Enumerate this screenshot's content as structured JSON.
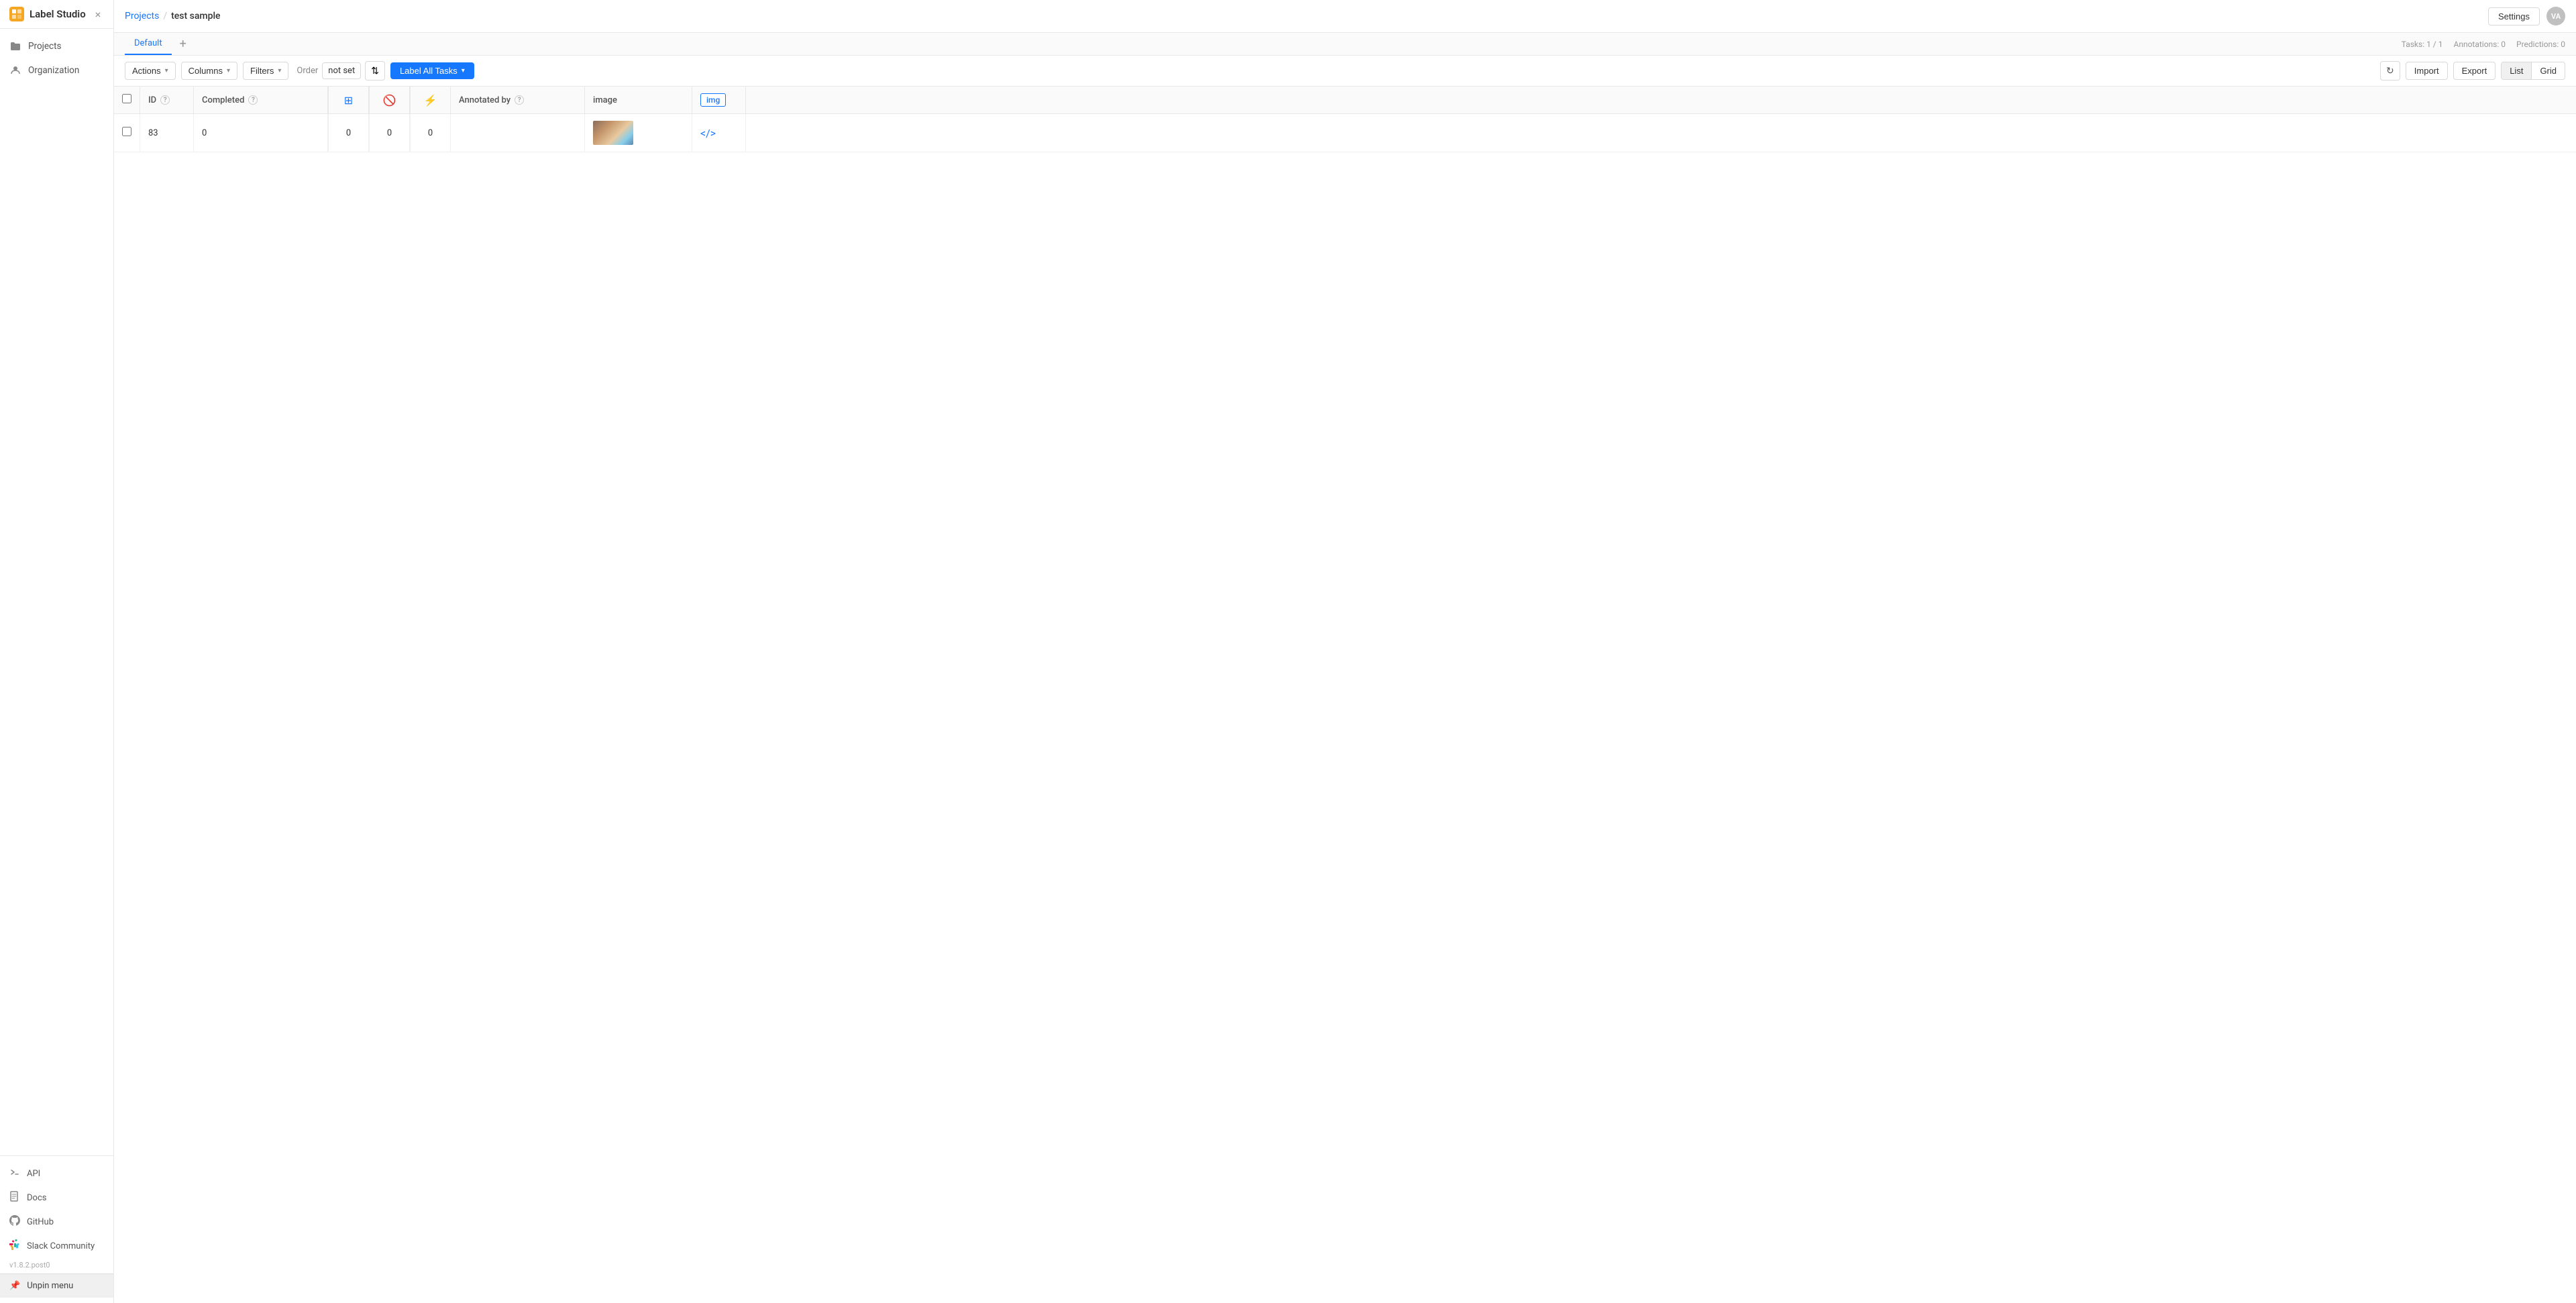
{
  "app": {
    "name": "Label Studio"
  },
  "sidebar": {
    "close_label": "×",
    "nav_items": [
      {
        "id": "projects",
        "label": "Projects",
        "icon": "folder"
      },
      {
        "id": "organization",
        "label": "Organization",
        "icon": "person"
      }
    ],
    "footer_items": [
      {
        "id": "api",
        "label": "API",
        "icon": "terminal"
      },
      {
        "id": "docs",
        "label": "Docs",
        "icon": "book"
      },
      {
        "id": "github",
        "label": "GitHub",
        "icon": "github"
      },
      {
        "id": "slack",
        "label": "Slack Community",
        "icon": "slack"
      }
    ],
    "version": "v1.8.2.post0",
    "unpin_label": "Unpin menu"
  },
  "topbar": {
    "breadcrumb_projects": "Projects",
    "breadcrumb_sep": "/",
    "breadcrumb_current": "test sample",
    "settings_label": "Settings",
    "user_initials": "VA"
  },
  "tabs": {
    "items": [
      {
        "id": "default",
        "label": "Default",
        "active": true
      }
    ],
    "add_tooltip": "+",
    "stats": {
      "tasks": "Tasks: 1 / 1",
      "annotations": "Annotations: 0",
      "predictions": "Predictions: 0"
    }
  },
  "toolbar": {
    "actions_label": "Actions",
    "columns_label": "Columns",
    "filters_label": "Filters",
    "order_label": "Order",
    "order_value": "not set",
    "label_all_label": "Label All Tasks",
    "import_label": "Import",
    "export_label": "Export",
    "view_list_label": "List",
    "view_grid_label": "Grid"
  },
  "table": {
    "columns": [
      {
        "id": "id",
        "label": "ID",
        "has_help": true
      },
      {
        "id": "completed",
        "label": "Completed",
        "has_help": true
      },
      {
        "id": "icon1",
        "label": "",
        "icon_type": "blue_grid",
        "has_help": false
      },
      {
        "id": "icon2",
        "label": "",
        "icon_type": "red_cancel",
        "has_help": false
      },
      {
        "id": "icon3",
        "label": "",
        "icon_type": "purple_lightning",
        "has_help": false
      },
      {
        "id": "annotated_by",
        "label": "Annotated by",
        "has_help": true
      },
      {
        "id": "image",
        "label": "image",
        "has_help": false
      },
      {
        "id": "img_badge",
        "label": "img",
        "badge": true,
        "has_help": false
      }
    ],
    "rows": [
      {
        "id": "83",
        "completed": "0",
        "icon1_val": "0",
        "icon2_val": "0",
        "icon3_val": "0",
        "annotated_by": "",
        "has_image": true,
        "has_code_icon": true
      }
    ]
  }
}
